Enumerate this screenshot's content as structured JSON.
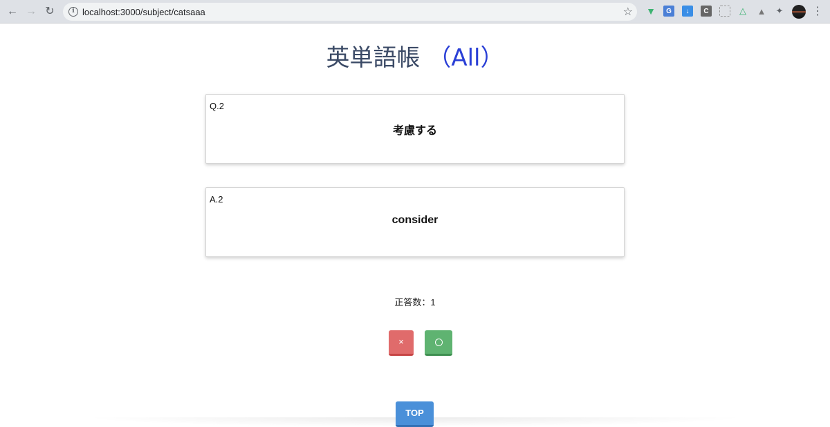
{
  "browser": {
    "url": "localhost:3000/subject/catsaaa",
    "back_icon": "arrow-left-icon",
    "forward_icon": "arrow-right-icon",
    "reload_icon": "reload-icon"
  },
  "page": {
    "title": "英単語帳",
    "subject": "（All）"
  },
  "question": {
    "label": "Q.2",
    "text": "考慮する"
  },
  "answer": {
    "label": "A.2",
    "text": "consider"
  },
  "score": {
    "text": "正答数：1"
  },
  "buttons": {
    "wrong": "×",
    "top": "TOP"
  },
  "colors": {
    "wrong": "#e06b6b",
    "correct": "#5fb371",
    "top": "#4a90d9",
    "title": "#3b4a66",
    "subject": "#2a3fd6"
  }
}
